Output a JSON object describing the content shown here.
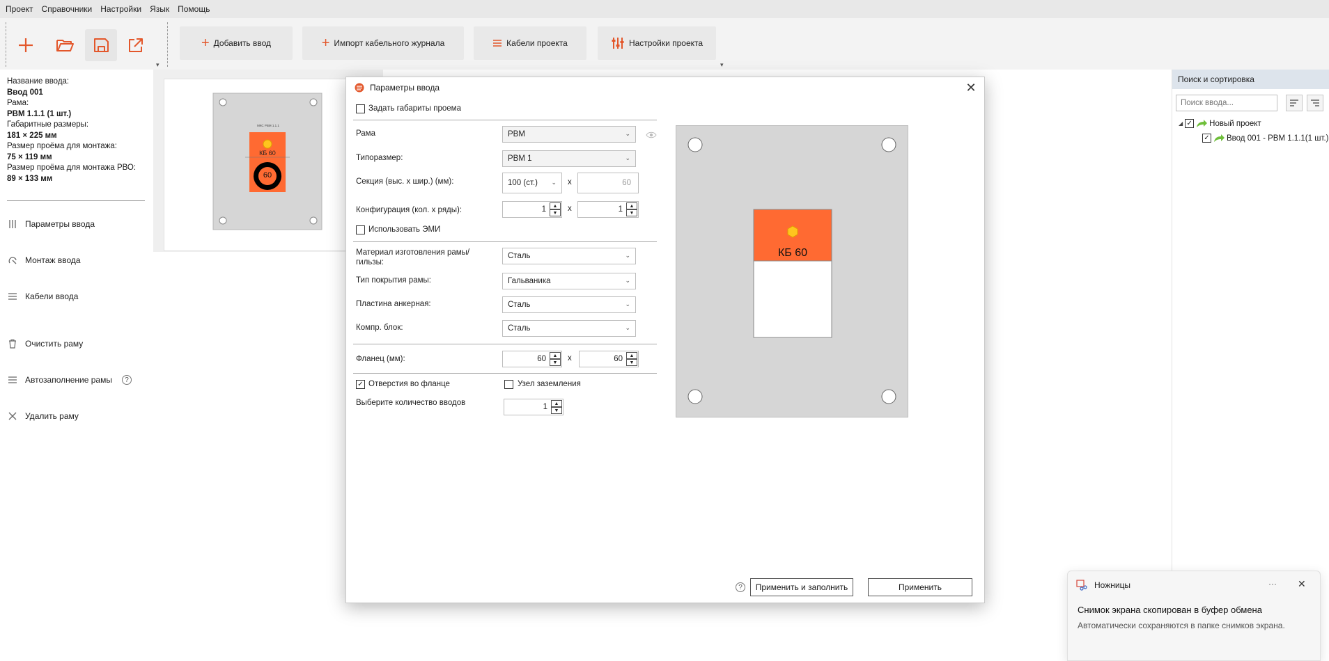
{
  "colors": {
    "accent": "#e3572b",
    "panel_header": "#dde4ec",
    "frame_gray": "#d6d6d6",
    "module_orange": "#ff6a32",
    "hex_yellow": "#ffc51e",
    "tree_arrow_green": "#6fbf3b"
  },
  "menu": [
    "Проект",
    "Справочники",
    "Настройки",
    "Язык",
    "Помощь"
  ],
  "toolbar": {
    "icons": [
      "plus-icon",
      "folder-open-icon",
      "save-icon",
      "export-icon"
    ],
    "add_entry": "Добавить ввод",
    "import_journal": "Импорт кабельного журнала",
    "project_cables": "Кабели проекта",
    "project_settings": "Настройки проекта"
  },
  "left": {
    "name_label": "Название ввода:",
    "name_value": "Ввод 001",
    "frame_label": "Рама:",
    "frame_value": "РВМ 1.1.1 (1 шт.)",
    "dims_label": "Габаритные размеры:",
    "dims_value": "181 × 225 мм",
    "opening_label": "Размер проёма для монтажа:",
    "opening_value": "75 × 119 мм",
    "opening_rvo_label": "Размер проёма для монтажа РВО:",
    "opening_rvo_value": "89 × 133 мм",
    "nav": [
      "Параметры ввода",
      "Монтаж ввода",
      "Кабели ввода",
      "Очистить раму",
      "Автозаполнение рамы",
      "Удалить раму"
    ],
    "nav_icons": [
      "sliders-icon",
      "mount-icon",
      "list-icon",
      "trash-icon",
      "list-icon",
      "close-icon"
    ]
  },
  "mini_preview": {
    "caption": "МКС РВМ 1.1.1",
    "module_label": "КБ 60",
    "circle_value": "60"
  },
  "right_panel": {
    "header": "Поиск и сортировка",
    "search_placeholder": "Поиск ввода...",
    "tree": [
      {
        "label": "Новый проект",
        "checked": true
      },
      {
        "label": "Ввод 001 - РВМ 1.1.1(1 шт.)",
        "checked": true
      }
    ]
  },
  "dialog": {
    "title": "Параметры ввода",
    "set_opening_dims": "Задать габариты проема",
    "frame_label": "Рама",
    "frame_value": "РВМ",
    "size_label": "Типоразмер:",
    "size_value": "РВМ 1",
    "section_label": "Секция (выс. х шир.) (мм):",
    "section_height": "100 (ст.)",
    "section_width": "60",
    "config_label": "Конфигурация (кол. х ряды):",
    "config_cols": "1",
    "config_rows": "1",
    "use_emi": "Использовать ЭМИ",
    "material_label": "Материал изготовления рамы/ гильзы:",
    "material_value": "Сталь",
    "coating_label": "Тип покрытия рамы:",
    "coating_value": "Гальваника",
    "anchor_label": "Пластина анкерная:",
    "anchor_value": "Сталь",
    "comp_label": "Компр. блок:",
    "comp_value": "Сталь",
    "flange_label": "Фланец (мм):",
    "flange_a": "60",
    "flange_b": "60",
    "flange_holes": "Отверстия во фланце",
    "flange_holes_checked": true,
    "grounding": "Узел заземления",
    "grounding_checked": false,
    "count_label": "Выберите количество вводов",
    "count_value": "1",
    "times": "x",
    "apply_fill": "Применить и заполнить",
    "apply": "Применить",
    "preview_module_label": "КБ 60"
  },
  "toast": {
    "app": "Ножницы",
    "title": "Снимок экрана скопирован в буфер обмена",
    "body": "Автоматически сохраняются в папке снимков экрана.",
    "more": "···"
  }
}
